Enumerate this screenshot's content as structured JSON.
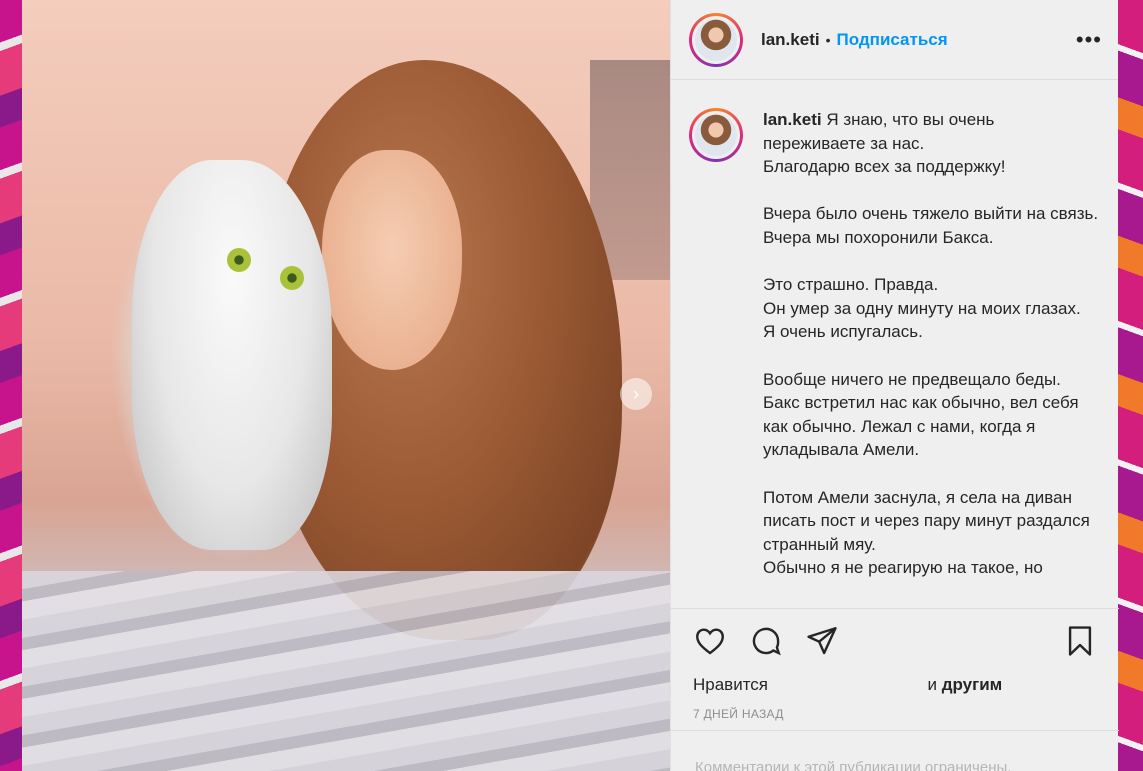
{
  "post": {
    "username": "lan.keti",
    "separator": "•",
    "follow_label": "Подписаться",
    "more_label": "•••",
    "next_label": "›",
    "caption": {
      "username": "lan.keti",
      "text": " Я знаю, что вы очень переживаете за нас.\nБлагодарю всех за поддержку!\n\nВчера было очень тяжело выйти на связь. Вчера мы похоронили Бакса.\n\nЭто страшно. Правда.\nОн умер за одну минуту на моих глазах.\nЯ очень испугалась.\n\nВообще ничего не предвещало беды. Бакс встретил нас как обычно, вел себя как обычно. Лежал с нами, когда я укладывала Амели.\n\nПотом Амели заснула, я села на диван писать пост и через пару минут раздался странный мяу.\nОбычно я не реагирую на такое, но"
    },
    "likes": {
      "prefix": "Нравится",
      "suffix_and": " и ",
      "others": "другим"
    },
    "time_ago": "7 ДНЕЙ НАЗАД",
    "comments_restricted": "Комментарии к этой публикации ограничены."
  },
  "colors": {
    "accent": "#0095f6",
    "text": "#262626",
    "muted": "#8e8e8e",
    "panel_bg": "#efefef"
  },
  "icons": {
    "like": "heart-icon",
    "comment": "comment-icon",
    "share": "paper-plane-icon",
    "save": "bookmark-icon"
  }
}
